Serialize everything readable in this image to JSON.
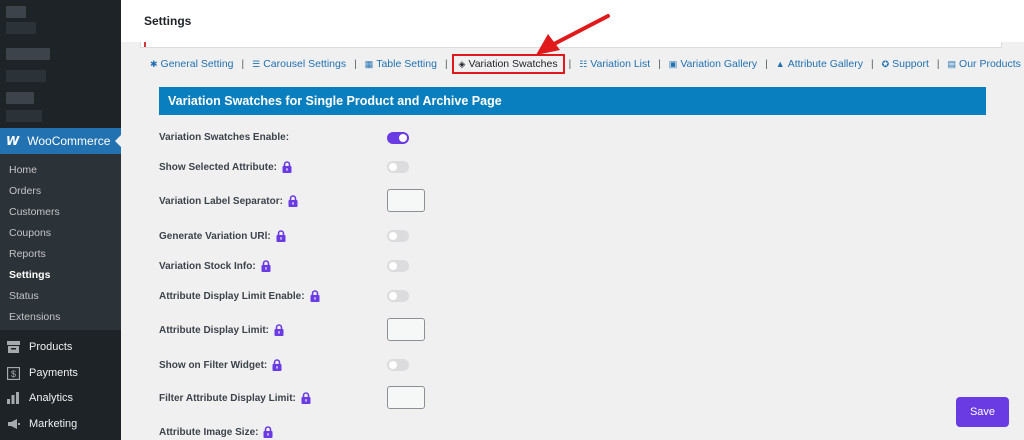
{
  "sidebar": {
    "woocommerce_label": "WooCommerce",
    "woocommerce_logo": "W",
    "submenu": [
      "Home",
      "Orders",
      "Customers",
      "Coupons",
      "Reports",
      "Settings",
      "Status",
      "Extensions"
    ],
    "active_submenu": "Settings",
    "main_items": [
      {
        "label": "Products",
        "icon": "archive-icon"
      },
      {
        "label": "Payments",
        "icon": "dollar-icon"
      },
      {
        "label": "Analytics",
        "icon": "bar-chart-icon"
      },
      {
        "label": "Marketing",
        "icon": "megaphone-icon"
      }
    ]
  },
  "header": {
    "title": "Settings"
  },
  "tabs": [
    {
      "label": "General Setting",
      "icon": "gear-icon"
    },
    {
      "label": "Carousel Settings",
      "icon": "sliders-icon"
    },
    {
      "label": "Table Setting",
      "icon": "table-icon"
    },
    {
      "label": "Variation Swatches",
      "icon": "layers-icon",
      "active": true
    },
    {
      "label": "Variation List",
      "icon": "list-icon"
    },
    {
      "label": "Variation Gallery",
      "icon": "image-icon"
    },
    {
      "label": "Attribute Gallery",
      "icon": "shapes-icon"
    },
    {
      "label": "Support",
      "icon": "support-icon"
    },
    {
      "label": "Our Products",
      "icon": "box-icon"
    }
  ],
  "section_title": "Variation Swatches for Single Product and Archive Page",
  "settings": [
    {
      "label": "Variation Swatches Enable:",
      "type": "toggle",
      "value": true,
      "locked": false
    },
    {
      "label": "Show Selected Attribute:",
      "type": "toggle",
      "value": false,
      "locked": true
    },
    {
      "label": "Variation Label Separator:",
      "type": "text",
      "value": "",
      "locked": true
    },
    {
      "label": "Generate Variation URl:",
      "type": "toggle",
      "value": false,
      "locked": true
    },
    {
      "label": "Variation Stock Info:",
      "type": "toggle",
      "value": false,
      "locked": true
    },
    {
      "label": "Attribute Display Limit Enable:",
      "type": "toggle",
      "value": false,
      "locked": true
    },
    {
      "label": "Attribute Display Limit:",
      "type": "text",
      "value": "",
      "locked": true
    },
    {
      "label": "Show on Filter Widget:",
      "type": "toggle",
      "value": false,
      "locked": true
    },
    {
      "label": "Filter Attribute Display Limit:",
      "type": "text",
      "value": "",
      "locked": true
    },
    {
      "label": "Attribute Image Size:",
      "type": "select",
      "value": "",
      "locked": true
    }
  ],
  "save_label": "Save",
  "colors": {
    "accent": "#6a3be3",
    "section_bar": "#0a7fbf",
    "sidebar": "#1d2327",
    "wc_active": "#2271b1",
    "annotation": "#e0191b"
  }
}
